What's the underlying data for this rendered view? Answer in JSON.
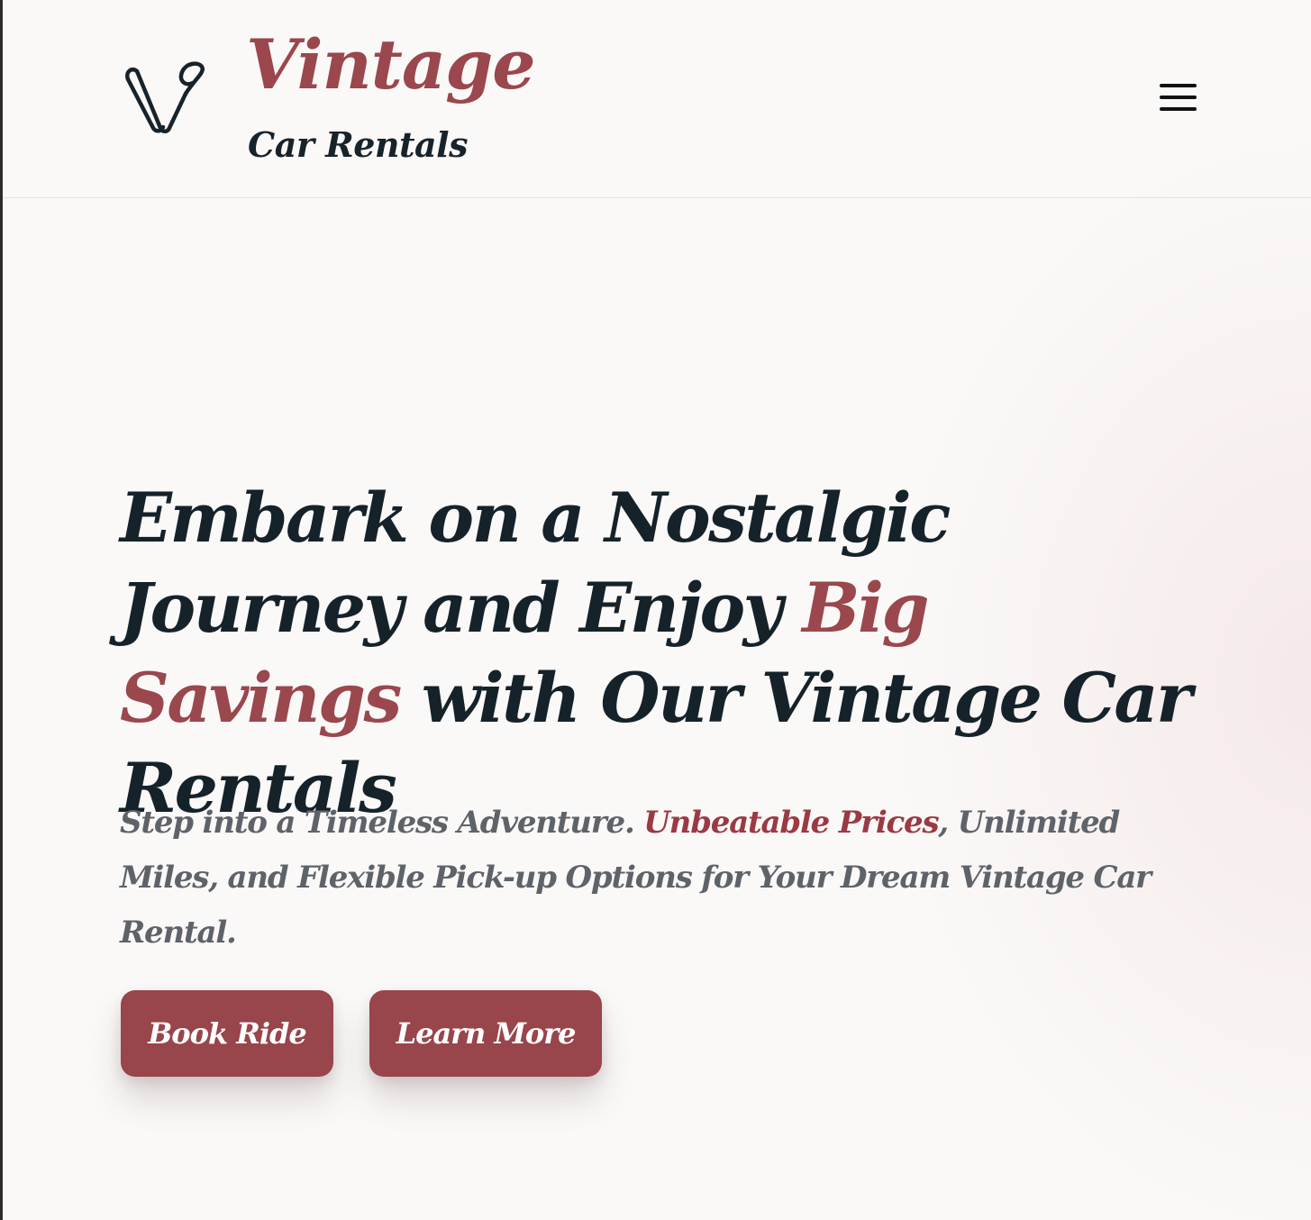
{
  "header": {
    "brand_name": "Vintage",
    "brand_subtitle": "Car Rentals",
    "logo_icon": "v-monogram-icon",
    "menu_icon": "hamburger-menu-icon"
  },
  "hero": {
    "title_part1": "Embark on a Nostalgic Journey and Enjoy ",
    "title_highlight": "Big Savings",
    "title_part2": " with Our Vintage Car Rentals",
    "subtitle_part1": "Step into a Timeless Adventure. ",
    "subtitle_highlight": "Unbeatable Prices",
    "subtitle_part2": ", Unlimited Miles, and Flexible Pick-up Options for Your Dream Vintage Car Rental."
  },
  "buttons": {
    "book_label": "Book Ride",
    "learn_label": "Learn More"
  },
  "colors": {
    "accent": "#9a474d",
    "heading": "#15222a",
    "body_text": "#5e636a",
    "button_bg": "#98454b",
    "background": "#fbf9f8"
  }
}
